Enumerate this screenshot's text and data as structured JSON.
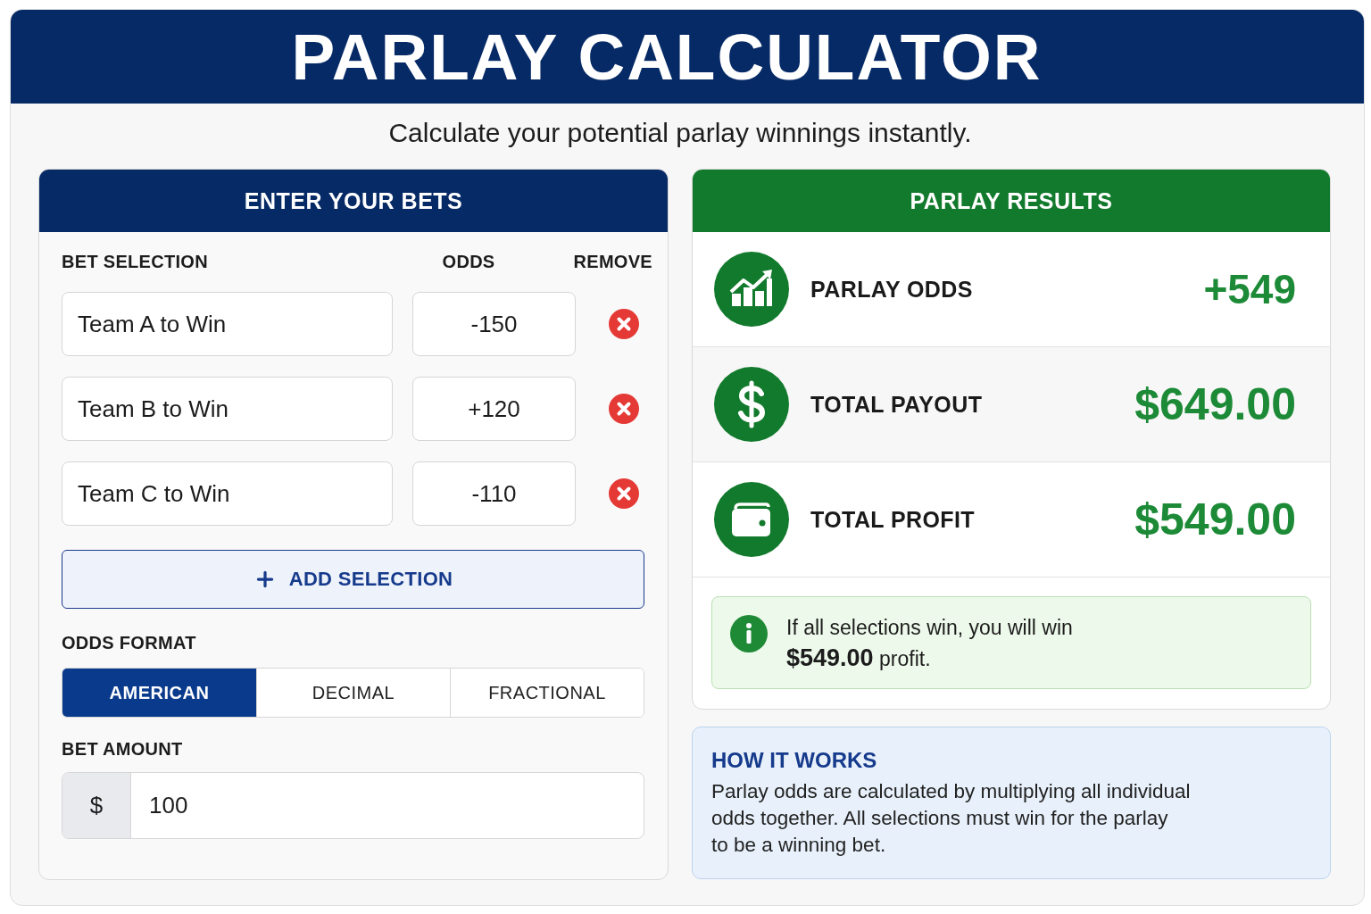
{
  "header": {
    "title": "PARLAY CALCULATOR",
    "subtitle": "Calculate your potential parlay winnings instantly."
  },
  "bets_panel": {
    "title": "ENTER YOUR BETS",
    "columns": [
      "BET SELECTION",
      "ODDS",
      "REMOVE"
    ],
    "bets": [
      {
        "selection": "Team A to Win",
        "odds": "-150"
      },
      {
        "selection": "Team B to Win",
        "odds": "+120"
      },
      {
        "selection": "Team C to Win",
        "odds": "-110"
      }
    ],
    "add_button": {
      "label": "ADD SELECTION"
    },
    "odds_format": {
      "label": "ODDS FORMAT",
      "options": [
        {
          "label": "AMERICAN",
          "selected": true
        },
        {
          "label": "DECIMAL",
          "selected": false
        },
        {
          "label": "FRACTIONAL",
          "selected": false
        }
      ]
    },
    "bet_amount": {
      "label": "BET AMOUNT",
      "currency": "$",
      "value": "100"
    }
  },
  "results_panel": {
    "title": "PARLAY RESULTS",
    "results": [
      {
        "kind": "odds",
        "label": "PARLAY ODDS",
        "value": "+549"
      },
      {
        "kind": "payout",
        "label": "TOTAL PAYOUT",
        "value": "$649.00"
      },
      {
        "kind": "profit",
        "label": "TOTAL PROFIT",
        "value": "$549.00"
      }
    ],
    "summary": "If all selections win, you will win **$549.00** profit."
  },
  "how_it_works": {
    "title": "HOW IT WORKS",
    "lines": [
      "Parlay odds are calculated by multiplying all individual",
      "odds together. All selections must win for the parlay",
      "to be a winning bet."
    ]
  }
}
